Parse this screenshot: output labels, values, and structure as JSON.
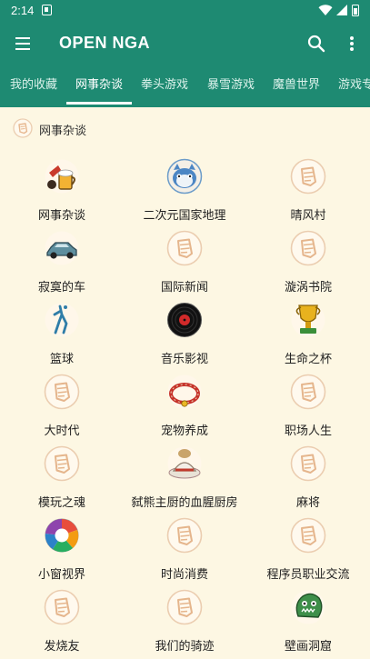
{
  "status_bar": {
    "time": "2:14",
    "icons": [
      "notification-icon",
      "wifi-icon",
      "signal-icon",
      "battery-icon"
    ]
  },
  "app_bar": {
    "title": "OPEN NGA",
    "icons": [
      "menu-icon",
      "search-icon",
      "more-vert-icon"
    ]
  },
  "tabs": [
    {
      "label": "我的收藏",
      "active": false
    },
    {
      "label": "网事杂谈",
      "active": true
    },
    {
      "label": "拳头游戏",
      "active": false
    },
    {
      "label": "暴雪游戏",
      "active": false
    },
    {
      "label": "魔兽世界",
      "active": false
    },
    {
      "label": "游戏专"
    }
  ],
  "section": {
    "title": "网事杂谈",
    "icon": "nga-fist-icon"
  },
  "boards": [
    {
      "label": "网事杂谈",
      "icon": "beer-mug-icon"
    },
    {
      "label": "二次元国家地理",
      "icon": "anime-cat-icon"
    },
    {
      "label": "晴风村",
      "icon": "nga-fist-icon"
    },
    {
      "label": "寂寞的车",
      "icon": "car-icon"
    },
    {
      "label": "国际新闻",
      "icon": "nga-fist-icon"
    },
    {
      "label": "漩涡书院",
      "icon": "nga-fist-icon"
    },
    {
      "label": "篮球",
      "icon": "basketball-player-icon"
    },
    {
      "label": "音乐影视",
      "icon": "vinyl-record-icon"
    },
    {
      "label": "生命之杯",
      "icon": "trophy-cup-icon"
    },
    {
      "label": "大时代",
      "icon": "nga-fist-icon"
    },
    {
      "label": "宠物养成",
      "icon": "pet-collar-icon"
    },
    {
      "label": "职场人生",
      "icon": "nga-fist-icon"
    },
    {
      "label": "模玩之魂",
      "icon": "nga-fist-icon"
    },
    {
      "label": "弑熊主厨的血腥厨房",
      "icon": "chef-dish-icon"
    },
    {
      "label": "麻将",
      "icon": "nga-fist-icon"
    },
    {
      "label": "小窗视界",
      "icon": "camera-aperture-icon"
    },
    {
      "label": "时尚消费",
      "icon": "nga-fist-icon"
    },
    {
      "label": "程序员职业交流",
      "icon": "nga-fist-icon"
    },
    {
      "label": "发烧友",
      "icon": "nga-fist-icon"
    },
    {
      "label": "我们的骑迹",
      "icon": "nga-fist-icon"
    },
    {
      "label": "壁画洞窟",
      "icon": "green-monster-icon"
    }
  ],
  "colors": {
    "primary": "#1E8A72",
    "background": "#FDF7E3",
    "placeholder_icon": "#E8C9A8"
  }
}
